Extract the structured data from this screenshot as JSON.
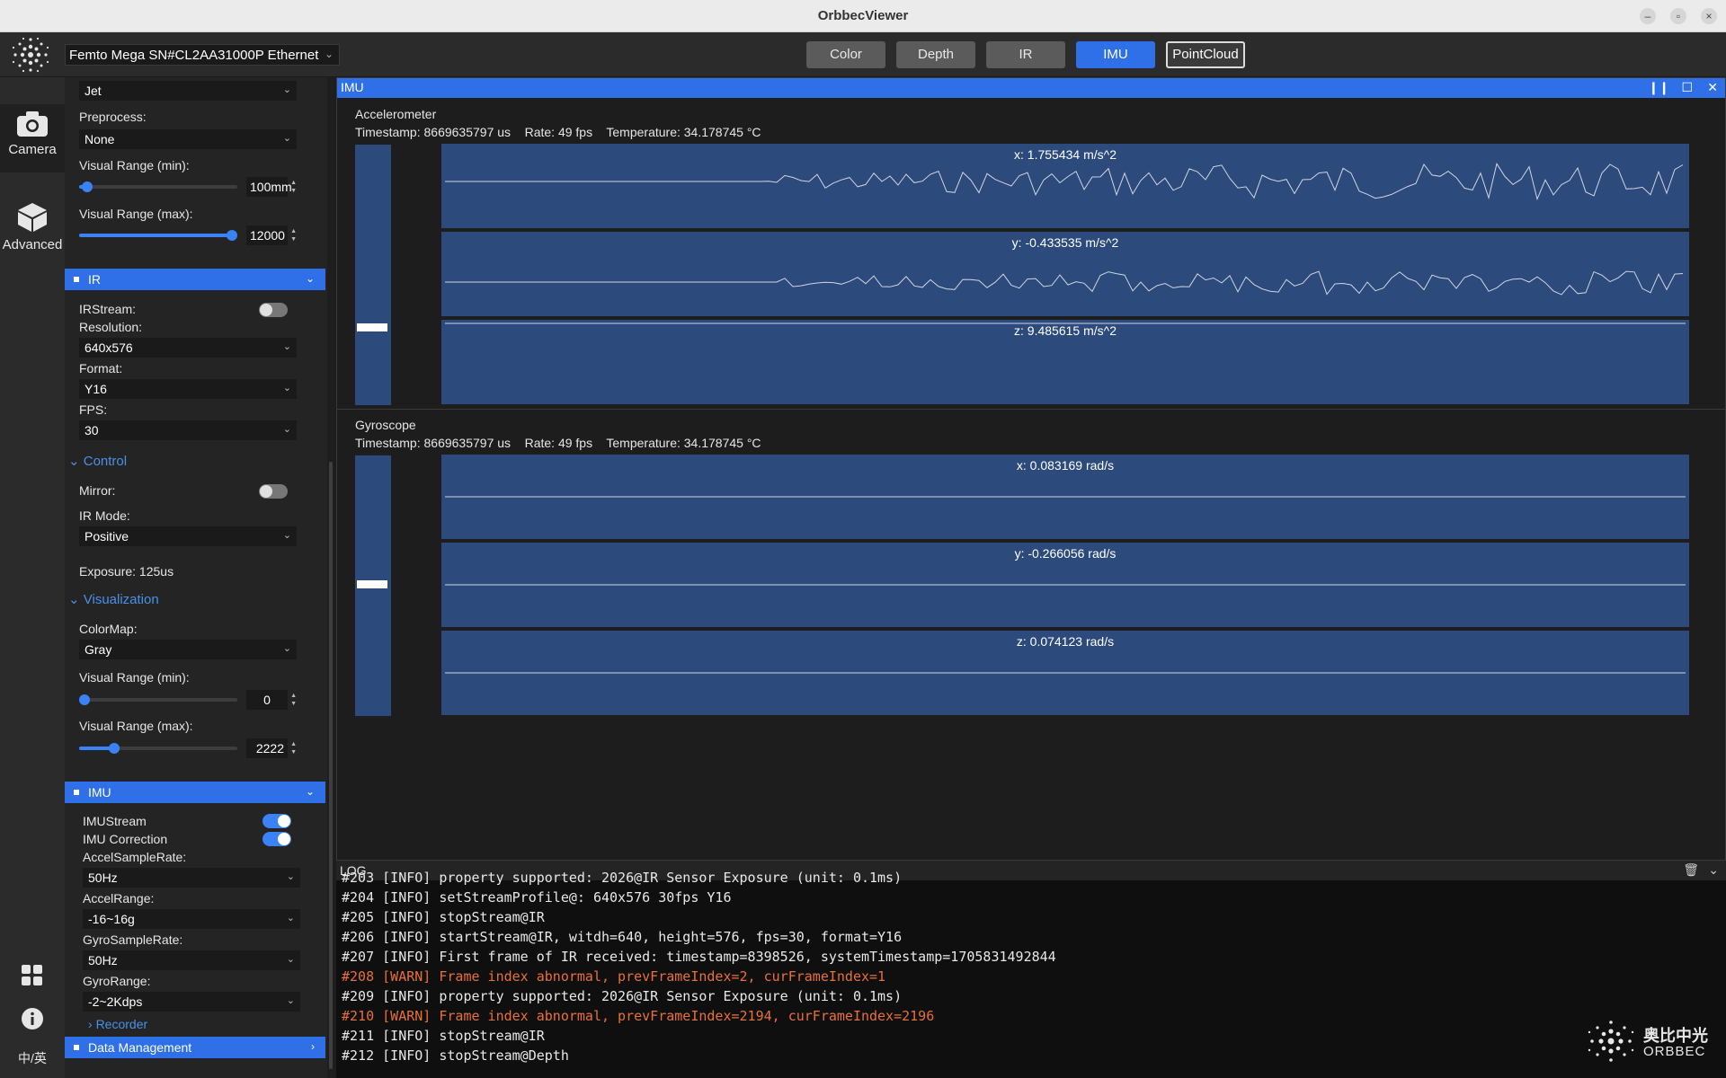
{
  "window": {
    "title": "OrbbecViewer"
  },
  "toolbar": {
    "device": "Femto Mega SN#CL2AA31000P Ethernet",
    "tabs": [
      {
        "label": "Color",
        "state": "normal"
      },
      {
        "label": "Depth",
        "state": "normal"
      },
      {
        "label": "IR",
        "state": "normal"
      },
      {
        "label": "IMU",
        "state": "active"
      },
      {
        "label": "PointCloud",
        "state": "outlined"
      }
    ]
  },
  "nav": {
    "camera": "Camera",
    "advanced": "Advanced",
    "lang": "中/英"
  },
  "side": {
    "depth_viz": {
      "colormap_value": "Jet",
      "preprocess_label": "Preprocess:",
      "preprocess_value": "None",
      "vr_min_label": "Visual Range (min):",
      "vr_min_value": "100mm",
      "vr_min_frac": 0.02,
      "vr_max_label": "Visual Range (max):",
      "vr_max_value": "12000",
      "vr_max_frac": 1.0
    },
    "ir": {
      "header": "IR",
      "stream_label": "IRStream:",
      "resolution_label": "Resolution:",
      "resolution_value": "640x576",
      "format_label": "Format:",
      "format_value": "Y16",
      "fps_label": "FPS:",
      "fps_value": "30",
      "control_label": "Control",
      "mirror_label": "Mirror:",
      "irmode_label": "IR Mode:",
      "irmode_value": "Positive",
      "exposure_label": "Exposure: 125us",
      "visualization_label": "Visualization",
      "colormap_label": "ColorMap:",
      "colormap_value": "Gray",
      "vr_min_label": "Visual Range (min):",
      "vr_min_value": "0",
      "vr_min_frac": 0.0,
      "vr_max_label": "Visual Range (max):",
      "vr_max_value": "2222",
      "vr_max_frac": 0.2
    },
    "imu": {
      "header": "IMU",
      "stream_label": "IMUStream",
      "correction_label": "IMU Correction",
      "accel_rate_label": "AccelSampleRate:",
      "accel_rate_value": "50Hz",
      "accel_range_label": "AccelRange:",
      "accel_range_value": "-16~16g",
      "gyro_rate_label": "GyroSampleRate:",
      "gyro_rate_value": "50Hz",
      "gyro_range_label": "GyroRange:",
      "gyro_range_value": "-2~2Kdps",
      "recorder_label": "Recorder"
    },
    "data_mgmt": "Data Management"
  },
  "imu_panel": {
    "title": "IMU",
    "accel": {
      "name": "Accelerometer",
      "info": "Timestamp: 8669635797 us    Rate: 49 fps    Temperature: 34.178745 °C",
      "x": "x: 1.755434 m/s^2",
      "y": "y: -0.433535 m/s^2",
      "z": "z: 9.485615 m/s^2"
    },
    "gyro": {
      "name": "Gyroscope",
      "info": "Timestamp: 8669635797 us    Rate: 49 fps    Temperature: 34.178745 °C",
      "x": "x: 0.083169 rad/s",
      "y": "y: -0.266056 rad/s",
      "z": "z: 0.074123 rad/s"
    }
  },
  "log": {
    "title": "LOG",
    "lines": [
      {
        "text": "#203 [INFO] property supported: 2026@IR Sensor Exposure (unit: 0.1ms)",
        "level": "info"
      },
      {
        "text": "#204 [INFO] setStreamProfile@: 640x576 30fps Y16",
        "level": "info"
      },
      {
        "text": "#205 [INFO] stopStream@IR",
        "level": "info"
      },
      {
        "text": "#206 [INFO] startStream@IR, witdh=640, height=576, fps=30, format=Y16",
        "level": "info"
      },
      {
        "text": "#207 [INFO] First frame of IR received: timestamp=8398526, systemTimestamp=1705831492844",
        "level": "info"
      },
      {
        "text": "#208 [WARN] Frame index abnormal, prevFrameIndex=2, curFrameIndex=1",
        "level": "warn"
      },
      {
        "text": "#209 [INFO] property supported: 2026@IR Sensor Exposure (unit: 0.1ms)",
        "level": "info"
      },
      {
        "text": "#210 [WARN] Frame index abnormal, prevFrameIndex=2194, curFrameIndex=2196",
        "level": "warn"
      },
      {
        "text": "#211 [INFO] stopStream@IR",
        "level": "info"
      },
      {
        "text": "#212 [INFO] stopStream@Depth",
        "level": "info"
      }
    ]
  },
  "brand": {
    "cn": "奥比中光",
    "en": "ORBBEC"
  },
  "colors": {
    "accent": "#2f6fe8",
    "plot_bg": "#2c4a7c",
    "warn": "#e8703a"
  }
}
